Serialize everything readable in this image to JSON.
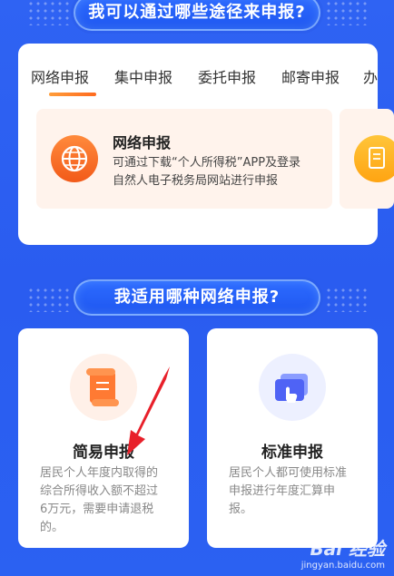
{
  "section1": {
    "title": "我可以通过哪些途径来申报?"
  },
  "tabs": [
    {
      "label": "网络申报"
    },
    {
      "label": "集中申报"
    },
    {
      "label": "委托申报"
    },
    {
      "label": "邮寄申报"
    },
    {
      "label": "办"
    }
  ],
  "method": {
    "title": "网络申报",
    "desc_line1": "可通过下载“个人所得税”APP及登录",
    "desc_line2": "自然人电子税务局网站进行申报"
  },
  "section2": {
    "title": "我适用哪种网络申报?"
  },
  "options": [
    {
      "title": "简易申报",
      "desc_lines": [
        "居民个人年度内取得的",
        "综合所得收入额不超过",
        "6万元，需要申请退税",
        "的。"
      ]
    },
    {
      "title": "标准申报",
      "desc_lines": [
        "居民个人都可使用标准",
        "申报进行年度汇算申",
        "报。"
      ]
    }
  ],
  "watermark": {
    "logo": "Bai 经验",
    "url": "jingyan.baidu.com"
  },
  "colors": {
    "background": "#2b5ff2",
    "accent": "#ff6a1e",
    "tab_text": "#333333"
  }
}
